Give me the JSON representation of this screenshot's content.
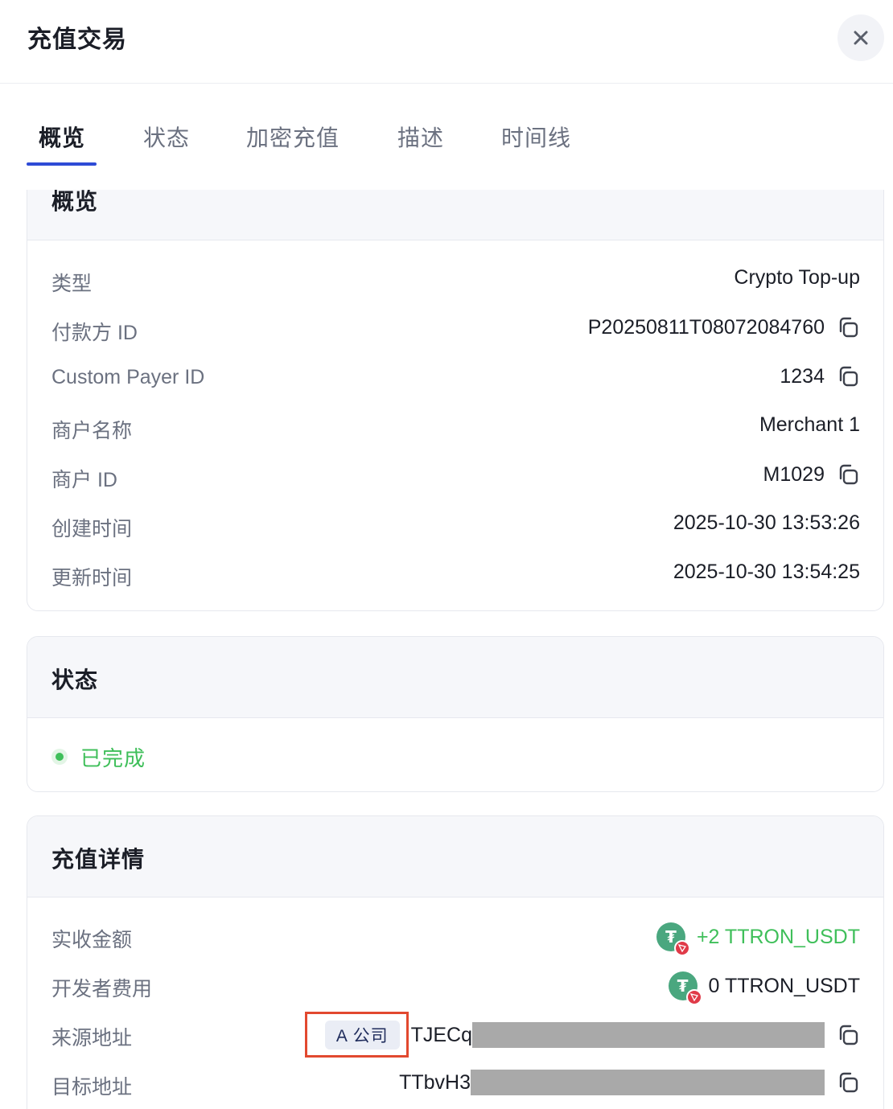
{
  "header": {
    "title": "充值交易"
  },
  "tabs": [
    {
      "label": "概览",
      "active": true
    },
    {
      "label": "状态"
    },
    {
      "label": "加密充值"
    },
    {
      "label": "描述"
    },
    {
      "label": "时间线"
    }
  ],
  "overview": {
    "title": "概览",
    "rows": [
      {
        "label": "类型",
        "value": "Crypto Top-up",
        "copy": false
      },
      {
        "label": "付款方 ID",
        "value": "P20250811T08072084760",
        "copy": true
      },
      {
        "label": "Custom Payer ID",
        "value": "1234",
        "copy": true
      },
      {
        "label": "商户名称",
        "value": "Merchant 1",
        "copy": false
      },
      {
        "label": "商户 ID",
        "value": "M1029",
        "copy": true
      },
      {
        "label": "创建时间",
        "value": "2025-10-30 13:53:26",
        "copy": false
      },
      {
        "label": "更新时间",
        "value": "2025-10-30 13:54:25",
        "copy": false
      }
    ]
  },
  "status": {
    "title": "状态",
    "text": "已完成",
    "color": "#3fbf5a"
  },
  "details": {
    "title": "充值详情",
    "received_label": "实收金额",
    "received_value": "+2 TTRON_USDT",
    "fee_label": "开发者费用",
    "fee_value": "0 TTRON_USDT",
    "source_label": "来源地址",
    "source_tag": "A 公司",
    "source_prefix": "TJECq",
    "source_suffix": "",
    "target_label": "目标地址",
    "target_prefix": "TTbvH3",
    "target_suffix": ""
  },
  "colors": {
    "accent": "#2e4bd6",
    "success": "#3fbf5a",
    "highlight": "#e2492f",
    "coin": "#4aa77f",
    "coin_badge": "#e03a48"
  },
  "icons": {
    "close": "close-icon",
    "copy": "copy-icon",
    "coin": "tether-icon",
    "network": "tron-icon"
  }
}
